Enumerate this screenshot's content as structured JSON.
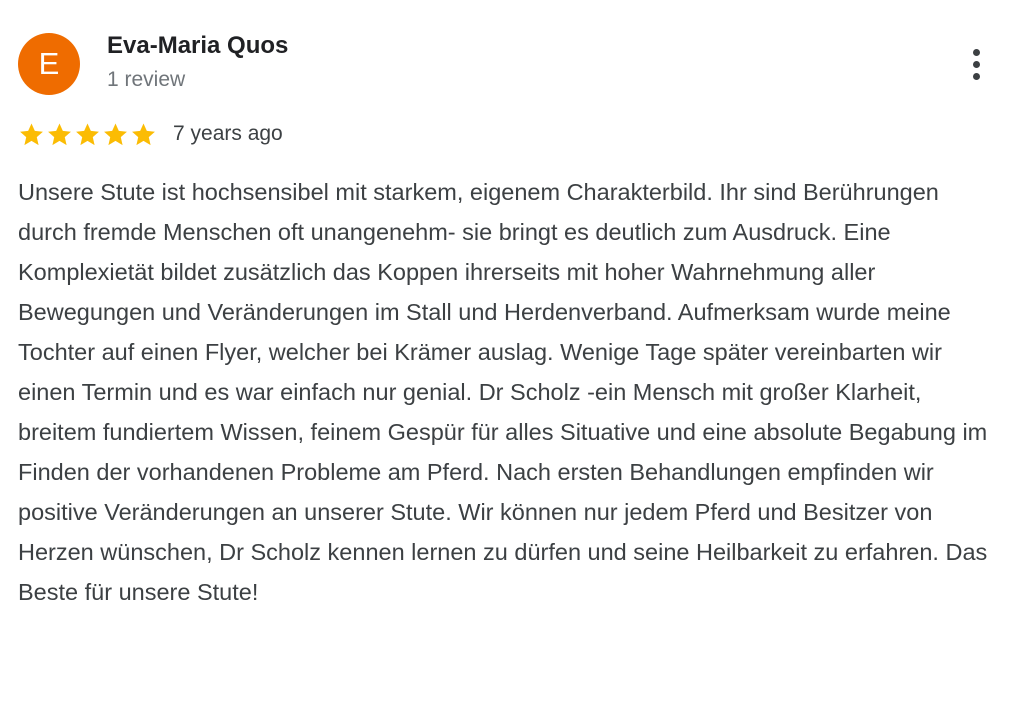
{
  "reviewer": {
    "avatar_initial": "E",
    "avatar_color": "#ef6c00",
    "name": "Eva-Maria Quos",
    "review_count": "1 review"
  },
  "rating": {
    "stars": 5,
    "max_stars": 5,
    "star_color": "#fbbc04",
    "date": "7 years ago"
  },
  "menu": {
    "icon": "more-vert-icon"
  },
  "review": {
    "text": "Unsere Stute ist hochsensibel mit starkem, eigenem Charakterbild. Ihr sind Berührungen durch fremde Menschen oft unangenehm- sie bringt es deutlich zum Ausdruck. Eine Komplexietät bildet zusätzlich das Koppen ihrerseits mit hoher Wahrnehmung aller Bewegungen und Veränderungen im Stall und Herdenverband. Aufmerksam wurde meine Tochter auf einen Flyer, welcher bei Krämer auslag. Wenige Tage später vereinbarten wir einen Termin und es war einfach nur genial. Dr Scholz -ein Mensch mit großer Klarheit, breitem fundiertem Wissen, feinem Gespür für alles Situative und eine absolute Begabung im Finden der vorhandenen Probleme am Pferd. Nach ersten Behandlungen empfinden wir positive Veränderungen an unserer Stute. Wir können nur jedem Pferd und Besitzer von Herzen wünschen, Dr Scholz kennen lernen zu dürfen und seine Heilbarkeit zu erfahren. Das Beste für unsere Stute!"
  }
}
